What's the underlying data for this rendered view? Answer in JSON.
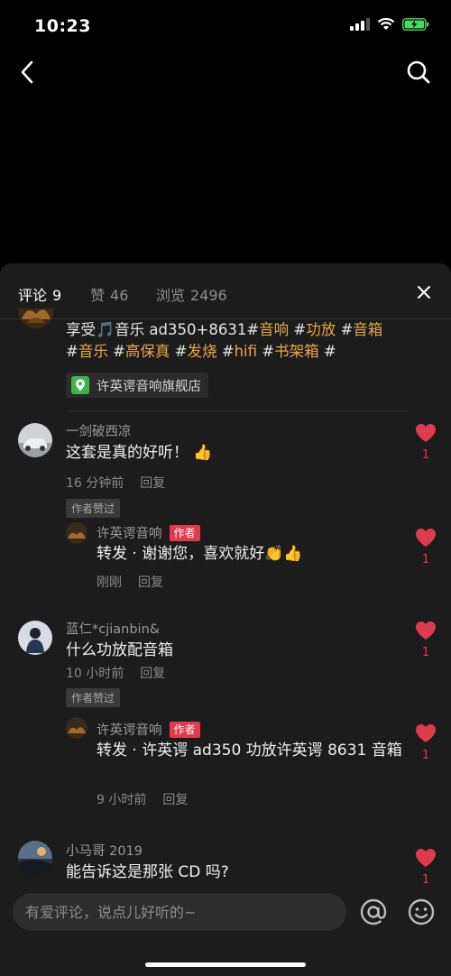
{
  "status_bar": {
    "time": "10:23"
  },
  "tabs": [
    {
      "label": "评论",
      "count": "9"
    },
    {
      "label": "赞",
      "count": "46"
    },
    {
      "label": "浏览",
      "count": "2496"
    }
  ],
  "post": {
    "text_parts": [
      {
        "text": "享受",
        "hl": false
      },
      {
        "text": "音乐 ad350+8631",
        "hl": false
      },
      {
        "text": "#",
        "hl": false
      },
      {
        "text": "音响",
        "hl": true
      },
      {
        "text": " #",
        "hl": false
      },
      {
        "text": "功放",
        "hl": true
      },
      {
        "text": " #",
        "hl": false
      },
      {
        "text": "音箱",
        "hl": true
      },
      {
        "text": "#",
        "hl": false
      },
      {
        "text": "音乐",
        "hl": true
      },
      {
        "text": " #",
        "hl": false
      },
      {
        "text": "高保真",
        "hl": true
      },
      {
        "text": " #",
        "hl": false
      },
      {
        "text": "发烧",
        "hl": true
      },
      {
        "text": " #",
        "hl": false
      },
      {
        "text": "hifi",
        "hl": true
      },
      {
        "text": " #",
        "hl": false
      },
      {
        "text": "书架箱",
        "hl": true
      },
      {
        "text": " #",
        "hl": false
      }
    ],
    "location": "许英谔音响旗舰店"
  },
  "comments": [
    {
      "name": "一剑破西凉",
      "text": "这套是真的好听！",
      "time": "16 分钟前",
      "reply": "回复",
      "badge": "作者赞过",
      "likes": "1",
      "reply_item": {
        "name": "许英谔音响",
        "author_tag": "作者",
        "text": "转发 · 谢谢您，喜欢就好",
        "time": "刚刚",
        "reply": "回复",
        "likes": "1"
      }
    },
    {
      "name": "蓝仁*cjianbin&",
      "text": "什么功放配音箱",
      "time": "10 小时前",
      "reply": "回复",
      "badge": "作者赞过",
      "likes": "1",
      "reply_item": {
        "name": "许英谔音响",
        "author_tag": "作者",
        "text": "转发 · 许英谔 ad350 功放许英谔 8631 音箱",
        "time": "9 小时前",
        "reply": "回复",
        "likes": "1"
      }
    },
    {
      "name": "小马哥 2019",
      "text": "能告诉这是那张 CD 吗?",
      "likes": "1"
    }
  ],
  "input": {
    "placeholder": "有爱评论，说点儿好听的~"
  },
  "colors": {
    "accent": "#e8a848",
    "like": "#e03a4e",
    "sheet_bg": "#1c1c1c"
  }
}
